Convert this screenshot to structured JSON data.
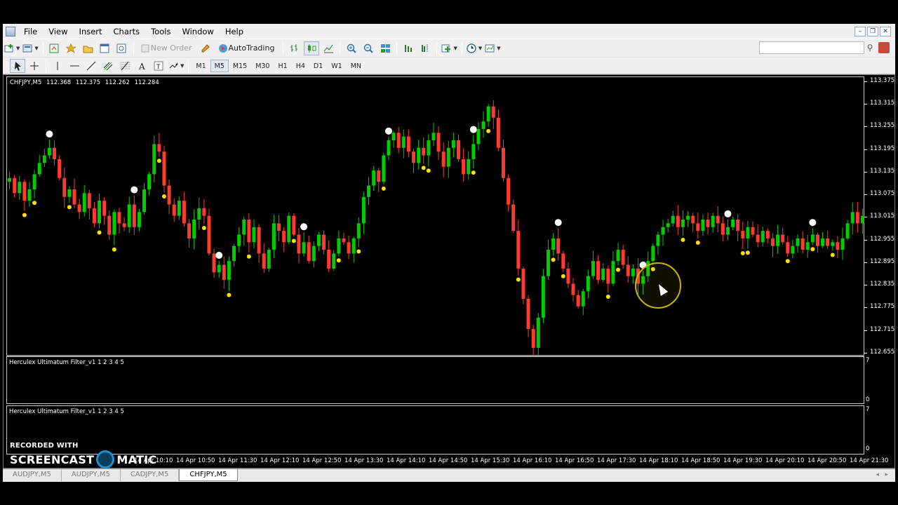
{
  "menu": {
    "items": [
      "File",
      "View",
      "Insert",
      "Charts",
      "Tools",
      "Window",
      "Help"
    ]
  },
  "toolbar": {
    "new_order_label": "New Order",
    "autotrading_label": "AutoTrading",
    "timeframes": [
      "M1",
      "M5",
      "M15",
      "M30",
      "H1",
      "H4",
      "D1",
      "W1",
      "MN"
    ],
    "active_timeframe": "M5",
    "search_placeholder": ""
  },
  "chart": {
    "symbol_header": "CHFJPY,M5",
    "ohlc": [
      "112.368",
      "112.375",
      "112.262",
      "112.284"
    ],
    "bull_color": "#00cc00",
    "bear_color": "#ff3b30",
    "background": "#000000"
  },
  "chart_data": {
    "type": "candlestick",
    "title": "CHFJPY,M5",
    "y_tick_labels": [
      "113.375",
      "113.315",
      "113.255",
      "113.195",
      "113.135",
      "113.075",
      "113.015",
      "112.955",
      "112.895",
      "112.835",
      "112.775",
      "112.715",
      "112.655"
    ],
    "ylim": [
      112.655,
      113.38
    ],
    "x_tick_labels": [
      "14 Apr 10:10",
      "14 Apr 10:50",
      "14 Apr 11:30",
      "14 Apr 12:10",
      "14 Apr 12:50",
      "14 Apr 13:30",
      "14 Apr 14:10",
      "14 Apr 14:50",
      "14 Apr 15:30",
      "14 Apr 16:10",
      "14 Apr 16:50",
      "14 Apr 17:30",
      "14 Apr 18:10",
      "14 Apr 18:50",
      "14 Apr 19:30",
      "14 Apr 20:10",
      "14 Apr 20:50",
      "14 Apr 21:30"
    ],
    "close_path": [
      113.12,
      113.08,
      113.11,
      113.06,
      113.09,
      113.13,
      113.16,
      113.18,
      113.2,
      113.17,
      113.12,
      113.07,
      113.09,
      113.05,
      113.03,
      113.08,
      113.04,
      113.0,
      113.06,
      113.02,
      112.97,
      113.03,
      113.0,
      112.99,
      113.05,
      112.99,
      113.03,
      113.09,
      113.13,
      113.21,
      113.19,
      113.1,
      113.05,
      113.02,
      113.06,
      113.0,
      112.96,
      113.01,
      113.04,
      113.02,
      112.92,
      112.87,
      112.89,
      112.85,
      112.9,
      112.94,
      112.97,
      113.01,
      112.95,
      112.99,
      112.92,
      112.88,
      112.93,
      113.0,
      112.98,
      112.95,
      113.02,
      112.97,
      112.92,
      112.95,
      112.9,
      112.94,
      112.97,
      112.93,
      112.88,
      112.92,
      112.96,
      112.95,
      112.92,
      112.96,
      113.0,
      113.07,
      113.1,
      113.14,
      113.11,
      113.18,
      113.22,
      113.24,
      113.2,
      113.23,
      113.19,
      113.16,
      113.2,
      113.18,
      113.22,
      113.24,
      113.19,
      113.15,
      113.2,
      113.22,
      113.17,
      113.13,
      113.17,
      113.21,
      113.25,
      113.27,
      113.31,
      113.28,
      113.2,
      113.12,
      113.05,
      112.98,
      112.88,
      112.8,
      112.72,
      112.67,
      112.75,
      112.86,
      112.93,
      112.96,
      112.92,
      112.88,
      112.84,
      112.81,
      112.78,
      112.82,
      112.86,
      112.9,
      112.85,
      112.88,
      112.84,
      112.9,
      112.93,
      112.89,
      112.86,
      112.88,
      112.84,
      112.86,
      112.9,
      112.94,
      112.97,
      112.99,
      113.0,
      113.02,
      112.99,
      113.01,
      113.02,
      113.0,
      112.98,
      113.01,
      112.99,
      113.02,
      113.0,
      112.97,
      112.99,
      113.01,
      112.98,
      112.96,
      112.99,
      112.97,
      112.95,
      112.98,
      112.96,
      112.94,
      112.97,
      112.95,
      112.92,
      112.94,
      112.96,
      112.93,
      112.95,
      112.97,
      112.94,
      112.96,
      112.94,
      112.95,
      112.93,
      112.96,
      113.0,
      113.03,
      113.0,
      113.02
    ]
  },
  "indicators": {
    "sub1_title": "Herculex Ultimatum Filter_v1 1 2 3 4 5",
    "sub1_max": "7",
    "sub1_min": "0",
    "sub2_title": "Herculex Ultimatum Filter_v1 1 2 3 4 5",
    "sub2_max": "7",
    "sub2_min": "0"
  },
  "watermark": {
    "top": "RECORDED WITH",
    "left": "SCREENCAST",
    "right": "MATIC"
  },
  "tabs": [
    "AUDJPY,M5",
    "AUDJPY,M5",
    "CADJPY,M5",
    "CHFJPY,M5"
  ],
  "active_tab": "CHFJPY,M5",
  "icons": [
    "new-chart-icon",
    "profiles-icon",
    "market-watch-icon",
    "navigator-icon",
    "terminal-icon",
    "tester-icon",
    "new-order-icon",
    "metaeditor-icon",
    "autotrading-icon",
    "bar-chart-icon",
    "candles-icon",
    "line-chart-icon",
    "zoom-in-icon",
    "zoom-out-icon",
    "tile-icon",
    "autoscroll-icon",
    "chart-shift-icon",
    "indicators-icon",
    "periods-icon",
    "templates-icon",
    "cursor-icon",
    "crosshair-icon",
    "vline-icon",
    "hline-icon",
    "trendline-icon",
    "equidistant-icon",
    "fibo-icon",
    "text-icon",
    "label-icon",
    "arrows-icon",
    "search-icon",
    "messages-icon"
  ]
}
